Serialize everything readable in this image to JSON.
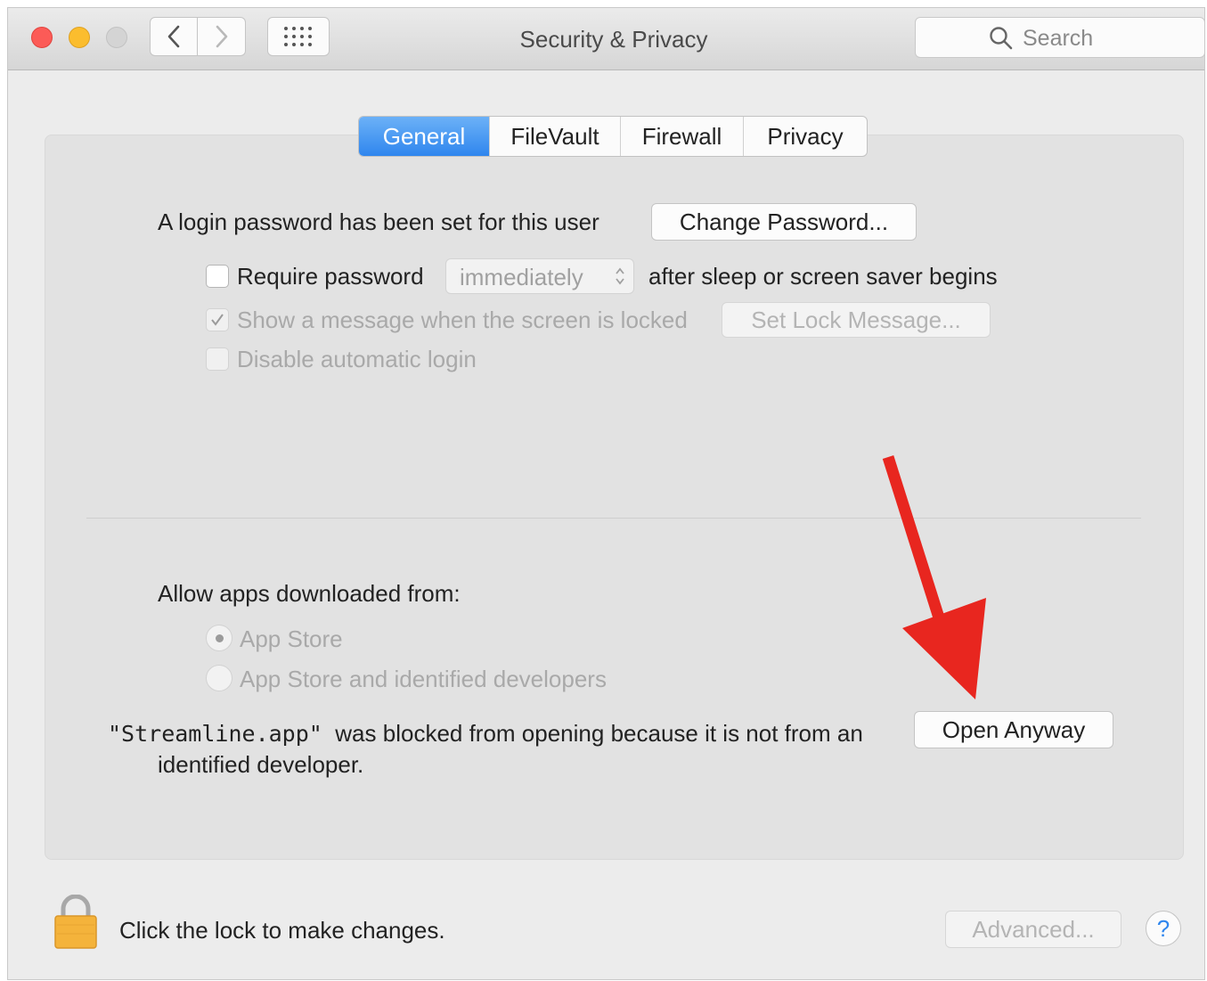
{
  "window": {
    "title": "Security & Privacy",
    "search": {
      "placeholder": "Search",
      "value": ""
    }
  },
  "tabs": [
    {
      "label": "General",
      "active": true
    },
    {
      "label": "FileVault",
      "active": false
    },
    {
      "label": "Firewall",
      "active": false
    },
    {
      "label": "Privacy",
      "active": false
    }
  ],
  "general": {
    "login_text": "A login password has been set for this user",
    "change_password_label": "Change Password...",
    "require_password": {
      "label": "Require password",
      "checked": false
    },
    "require_select": {
      "selected": "immediately",
      "enabled": false
    },
    "after_sleep_text": "after sleep or screen saver begins",
    "show_message": {
      "label": "Show a message when the screen is locked",
      "checked": true,
      "enabled": false
    },
    "set_lock_message_label": "Set Lock Message...",
    "disable_auto_login": {
      "label": "Disable automatic login",
      "checked": false,
      "enabled": false
    }
  },
  "allow_apps": {
    "heading": "Allow apps downloaded from:",
    "options": [
      {
        "label": "App Store",
        "selected": true
      },
      {
        "label": "App Store and identified developers",
        "selected": false
      }
    ],
    "blocked_app": "\"Streamline.app\"",
    "blocked_line1": "was blocked from opening because it is not from an",
    "blocked_line2": "identified developer.",
    "open_anyway_label": "Open Anyway"
  },
  "footer": {
    "lock_text": "Click the lock to make changes.",
    "advanced_label": "Advanced...",
    "help_label": "?"
  },
  "colors": {
    "accent": "#2f86ee",
    "arrow": "#e8261f",
    "close": "#fc5b57",
    "minimize": "#fbbd2e",
    "lock_body": "#f4b33b"
  },
  "icons": [
    "chevron-left-icon",
    "chevron-right-icon",
    "grid-icon",
    "search-icon",
    "checkmark-icon",
    "stepper-chevron-icon",
    "lock-icon",
    "red-arrow-icon"
  ]
}
